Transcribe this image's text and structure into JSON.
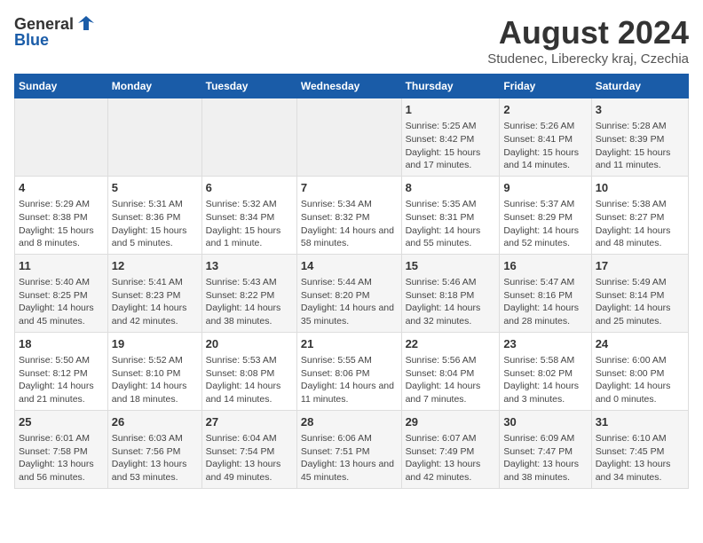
{
  "logo": {
    "text_general": "General",
    "text_blue": "Blue"
  },
  "title": "August 2024",
  "subtitle": "Studenec, Liberecky kraj, Czechia",
  "days_of_week": [
    "Sunday",
    "Monday",
    "Tuesday",
    "Wednesday",
    "Thursday",
    "Friday",
    "Saturday"
  ],
  "weeks": [
    [
      {
        "day": "",
        "sunrise": "",
        "sunset": "",
        "daylight": ""
      },
      {
        "day": "",
        "sunrise": "",
        "sunset": "",
        "daylight": ""
      },
      {
        "day": "",
        "sunrise": "",
        "sunset": "",
        "daylight": ""
      },
      {
        "day": "",
        "sunrise": "",
        "sunset": "",
        "daylight": ""
      },
      {
        "day": "1",
        "sunrise": "Sunrise: 5:25 AM",
        "sunset": "Sunset: 8:42 PM",
        "daylight": "Daylight: 15 hours and 17 minutes."
      },
      {
        "day": "2",
        "sunrise": "Sunrise: 5:26 AM",
        "sunset": "Sunset: 8:41 PM",
        "daylight": "Daylight: 15 hours and 14 minutes."
      },
      {
        "day": "3",
        "sunrise": "Sunrise: 5:28 AM",
        "sunset": "Sunset: 8:39 PM",
        "daylight": "Daylight: 15 hours and 11 minutes."
      }
    ],
    [
      {
        "day": "4",
        "sunrise": "Sunrise: 5:29 AM",
        "sunset": "Sunset: 8:38 PM",
        "daylight": "Daylight: 15 hours and 8 minutes."
      },
      {
        "day": "5",
        "sunrise": "Sunrise: 5:31 AM",
        "sunset": "Sunset: 8:36 PM",
        "daylight": "Daylight: 15 hours and 5 minutes."
      },
      {
        "day": "6",
        "sunrise": "Sunrise: 5:32 AM",
        "sunset": "Sunset: 8:34 PM",
        "daylight": "Daylight: 15 hours and 1 minute."
      },
      {
        "day": "7",
        "sunrise": "Sunrise: 5:34 AM",
        "sunset": "Sunset: 8:32 PM",
        "daylight": "Daylight: 14 hours and 58 minutes."
      },
      {
        "day": "8",
        "sunrise": "Sunrise: 5:35 AM",
        "sunset": "Sunset: 8:31 PM",
        "daylight": "Daylight: 14 hours and 55 minutes."
      },
      {
        "day": "9",
        "sunrise": "Sunrise: 5:37 AM",
        "sunset": "Sunset: 8:29 PM",
        "daylight": "Daylight: 14 hours and 52 minutes."
      },
      {
        "day": "10",
        "sunrise": "Sunrise: 5:38 AM",
        "sunset": "Sunset: 8:27 PM",
        "daylight": "Daylight: 14 hours and 48 minutes."
      }
    ],
    [
      {
        "day": "11",
        "sunrise": "Sunrise: 5:40 AM",
        "sunset": "Sunset: 8:25 PM",
        "daylight": "Daylight: 14 hours and 45 minutes."
      },
      {
        "day": "12",
        "sunrise": "Sunrise: 5:41 AM",
        "sunset": "Sunset: 8:23 PM",
        "daylight": "Daylight: 14 hours and 42 minutes."
      },
      {
        "day": "13",
        "sunrise": "Sunrise: 5:43 AM",
        "sunset": "Sunset: 8:22 PM",
        "daylight": "Daylight: 14 hours and 38 minutes."
      },
      {
        "day": "14",
        "sunrise": "Sunrise: 5:44 AM",
        "sunset": "Sunset: 8:20 PM",
        "daylight": "Daylight: 14 hours and 35 minutes."
      },
      {
        "day": "15",
        "sunrise": "Sunrise: 5:46 AM",
        "sunset": "Sunset: 8:18 PM",
        "daylight": "Daylight: 14 hours and 32 minutes."
      },
      {
        "day": "16",
        "sunrise": "Sunrise: 5:47 AM",
        "sunset": "Sunset: 8:16 PM",
        "daylight": "Daylight: 14 hours and 28 minutes."
      },
      {
        "day": "17",
        "sunrise": "Sunrise: 5:49 AM",
        "sunset": "Sunset: 8:14 PM",
        "daylight": "Daylight: 14 hours and 25 minutes."
      }
    ],
    [
      {
        "day": "18",
        "sunrise": "Sunrise: 5:50 AM",
        "sunset": "Sunset: 8:12 PM",
        "daylight": "Daylight: 14 hours and 21 minutes."
      },
      {
        "day": "19",
        "sunrise": "Sunrise: 5:52 AM",
        "sunset": "Sunset: 8:10 PM",
        "daylight": "Daylight: 14 hours and 18 minutes."
      },
      {
        "day": "20",
        "sunrise": "Sunrise: 5:53 AM",
        "sunset": "Sunset: 8:08 PM",
        "daylight": "Daylight: 14 hours and 14 minutes."
      },
      {
        "day": "21",
        "sunrise": "Sunrise: 5:55 AM",
        "sunset": "Sunset: 8:06 PM",
        "daylight": "Daylight: 14 hours and 11 minutes."
      },
      {
        "day": "22",
        "sunrise": "Sunrise: 5:56 AM",
        "sunset": "Sunset: 8:04 PM",
        "daylight": "Daylight: 14 hours and 7 minutes."
      },
      {
        "day": "23",
        "sunrise": "Sunrise: 5:58 AM",
        "sunset": "Sunset: 8:02 PM",
        "daylight": "Daylight: 14 hours and 3 minutes."
      },
      {
        "day": "24",
        "sunrise": "Sunrise: 6:00 AM",
        "sunset": "Sunset: 8:00 PM",
        "daylight": "Daylight: 14 hours and 0 minutes."
      }
    ],
    [
      {
        "day": "25",
        "sunrise": "Sunrise: 6:01 AM",
        "sunset": "Sunset: 7:58 PM",
        "daylight": "Daylight: 13 hours and 56 minutes."
      },
      {
        "day": "26",
        "sunrise": "Sunrise: 6:03 AM",
        "sunset": "Sunset: 7:56 PM",
        "daylight": "Daylight: 13 hours and 53 minutes."
      },
      {
        "day": "27",
        "sunrise": "Sunrise: 6:04 AM",
        "sunset": "Sunset: 7:54 PM",
        "daylight": "Daylight: 13 hours and 49 minutes."
      },
      {
        "day": "28",
        "sunrise": "Sunrise: 6:06 AM",
        "sunset": "Sunset: 7:51 PM",
        "daylight": "Daylight: 13 hours and 45 minutes."
      },
      {
        "day": "29",
        "sunrise": "Sunrise: 6:07 AM",
        "sunset": "Sunset: 7:49 PM",
        "daylight": "Daylight: 13 hours and 42 minutes."
      },
      {
        "day": "30",
        "sunrise": "Sunrise: 6:09 AM",
        "sunset": "Sunset: 7:47 PM",
        "daylight": "Daylight: 13 hours and 38 minutes."
      },
      {
        "day": "31",
        "sunrise": "Sunrise: 6:10 AM",
        "sunset": "Sunset: 7:45 PM",
        "daylight": "Daylight: 13 hours and 34 minutes."
      }
    ]
  ]
}
